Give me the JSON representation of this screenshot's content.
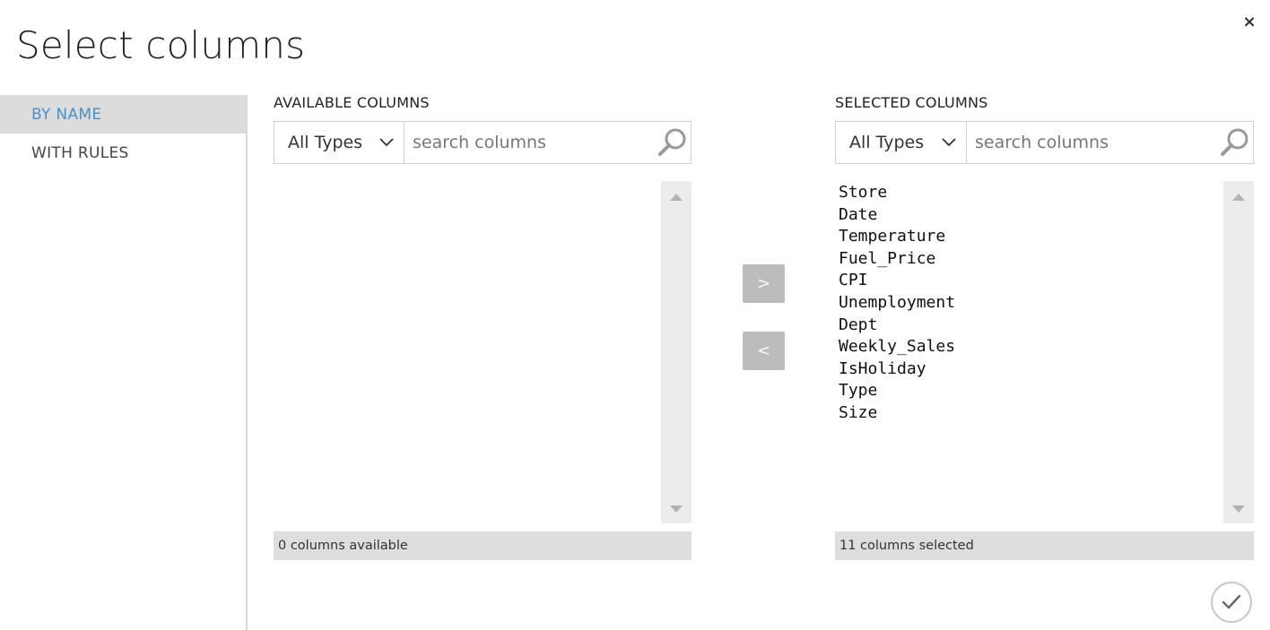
{
  "dialog": {
    "title": "Select columns",
    "close_glyph": "×"
  },
  "sidebar": {
    "items": [
      {
        "label": "BY NAME",
        "active": true
      },
      {
        "label": "WITH RULES",
        "active": false
      }
    ]
  },
  "available": {
    "header": "AVAILABLE COLUMNS",
    "type_filter": "All Types",
    "search_placeholder": "search columns",
    "columns": [],
    "status": "0 columns available"
  },
  "selected": {
    "header": "SELECTED COLUMNS",
    "type_filter": "All Types",
    "search_placeholder": "search columns",
    "columns": [
      "Store",
      "Date",
      "Temperature",
      "Fuel_Price",
      "CPI",
      "Unemployment",
      "Dept",
      "Weekly_Sales",
      "IsHoliday",
      "Type",
      "Size"
    ],
    "status": "11 columns selected"
  },
  "actions": {
    "add_label": ">",
    "remove_label": "<",
    "confirm_icon": "checkmark-icon"
  },
  "colors": {
    "accent": "#4a90c9",
    "active_bg": "#dcdcdc",
    "button_bg": "#bcbcbc",
    "status_bg": "#dedede",
    "scroll_track": "#ececec"
  }
}
